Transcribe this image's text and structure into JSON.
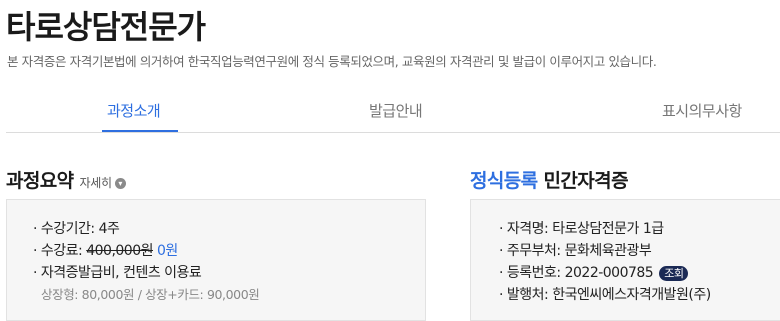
{
  "header": {
    "title": "타로상담전문가",
    "subtitle": "본 자격증은 자격기본법에 의거하여 한국직업능력연구원에 정식 등록되었으며, 교육원의 자격관리 및 발급이 이루어지고 있습니다."
  },
  "tabs": [
    {
      "label": "과정소개",
      "active": true
    },
    {
      "label": "발급안내",
      "active": false
    },
    {
      "label": "표시의무사항",
      "active": false
    }
  ],
  "summary": {
    "title": "과정요약",
    "detail_label": "자세히",
    "period_label": "· 수강기간: ",
    "period_value": "4주",
    "fee_label": "· 수강료: ",
    "fee_original": "400,000원",
    "fee_discounted": "0원",
    "extra_label": "· 자격증발급비, 컨텐츠 이용료",
    "extra_note": "상장형: 80,000원 / 상장+카드: 90,000원"
  },
  "certificate": {
    "title_accent": "정식등록",
    "title_rest": " 민간자격증",
    "name_line": "· 자격명: 타로상담전문가 1급",
    "ministry_line": "· 주무부처: 문화체육관광부",
    "reg_label": "· 등록번호: ",
    "reg_number": "2022-000785",
    "lookup_label": "조회",
    "issuer_line": "· 발행처: 한국엔씨에스자격개발원(주)"
  },
  "colors": {
    "accent": "#2e6fe0",
    "badge": "#1b2a55"
  }
}
